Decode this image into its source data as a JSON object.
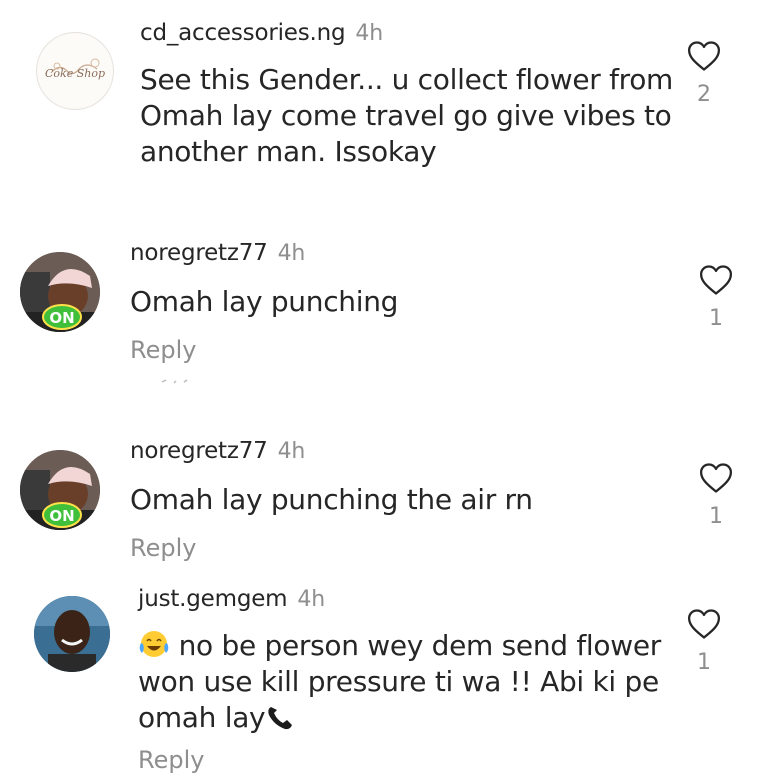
{
  "comments": [
    {
      "username": "cd_accessories.ng",
      "time": "4h",
      "lines": [
        "See this Gender... u collect flower from",
        "Omah lay come travel go give vibes to",
        "another man. Issokay"
      ],
      "likes": "2",
      "avatar_logo_text": "Coke Shop"
    },
    {
      "username": "noregretz77",
      "time": "4h",
      "text": "Omah lay punching",
      "reply_label": "Reply",
      "likes": "1",
      "avatar_badge": "ON"
    },
    {
      "username": "noregretz77",
      "time": "4h",
      "text": "Omah lay punching the air rn",
      "reply_label": "Reply",
      "likes": "1",
      "avatar_badge": "ON"
    },
    {
      "username": "just.gemgem",
      "time": "4h",
      "line1": "no be person wey dem send flower",
      "line2": "won use kill pressure ti wa !! Abi ki pe",
      "line3": "omah lay",
      "reply_label": "Reply",
      "likes": "1",
      "emoji_start": "joy-emoji",
      "emoji_end": "telephone-emoji"
    }
  ],
  "colors": {
    "text": "#262626",
    "muted": "#8e8e8e",
    "badge_green": "#3fbf3a"
  }
}
